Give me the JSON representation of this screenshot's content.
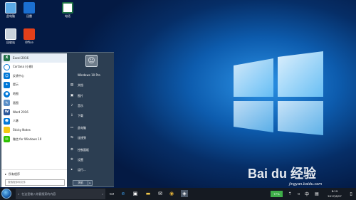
{
  "desktop": {
    "icons": [
      {
        "label": "此电脑",
        "icon": "computer-icon"
      },
      {
        "label": "迅雷",
        "icon": "thunder-icon"
      },
      {
        "label": "电话",
        "icon": "excel-file-icon"
      },
      {
        "label": "回收站",
        "icon": "recycle-bin-icon"
      },
      {
        "label": "Office",
        "icon": "office-icon"
      }
    ]
  },
  "start_menu": {
    "apps": [
      {
        "label": "Excel 2016",
        "icon": "excel-icon",
        "color": "#1e7145"
      },
      {
        "label": "Cortana (小娜)",
        "icon": "cortana-icon",
        "color": "#0078d7"
      },
      {
        "label": "反馈中心",
        "icon": "feedback-icon",
        "color": "#0078d7"
      },
      {
        "label": "提示",
        "icon": "tips-icon",
        "color": "#0078d7"
      },
      {
        "label": "地图",
        "icon": "maps-icon",
        "color": "#0078d7"
      },
      {
        "label": "画图",
        "icon": "paint-icon",
        "color": "#5b8fc7"
      },
      {
        "label": "Word 2016",
        "icon": "word-icon",
        "color": "#2b579a"
      },
      {
        "label": "人脉",
        "icon": "people-icon",
        "color": "#0078d7"
      },
      {
        "label": "Sticky Notes",
        "icon": "sticky-notes-icon",
        "color": "#f2c811"
      },
      {
        "label": "微信 for Windows 10",
        "icon": "wechat-icon",
        "color": "#2dc100"
      }
    ],
    "all_programs": "所有程序",
    "search_placeholder": "搜索程序和文件",
    "user_items": [
      {
        "label": "Windows 10 Pro",
        "glyph": ""
      },
      {
        "label": "文档",
        "glyph": "▤"
      },
      {
        "label": "图片",
        "glyph": "▣"
      },
      {
        "label": "音乐",
        "glyph": "♪"
      },
      {
        "label": "下载",
        "glyph": "⇩"
      },
      {
        "label": "此电脑",
        "glyph": "▭"
      },
      {
        "label": "连接到",
        "glyph": "⇆"
      },
      {
        "label": "控制面板",
        "glyph": "⚙"
      },
      {
        "label": "设置",
        "glyph": "✲"
      },
      {
        "label": "运行...",
        "glyph": "▸"
      }
    ],
    "shutdown": "关机",
    "shutdown_arrow": "▸"
  },
  "taskbar": {
    "search_placeholder": "在这里输入你要搜索的内容",
    "battery": "77%",
    "time": "8:19",
    "date": "2017/6/27"
  },
  "watermark": {
    "brand": "Bai du 经验",
    "url": "jingyan.baidu.com"
  }
}
